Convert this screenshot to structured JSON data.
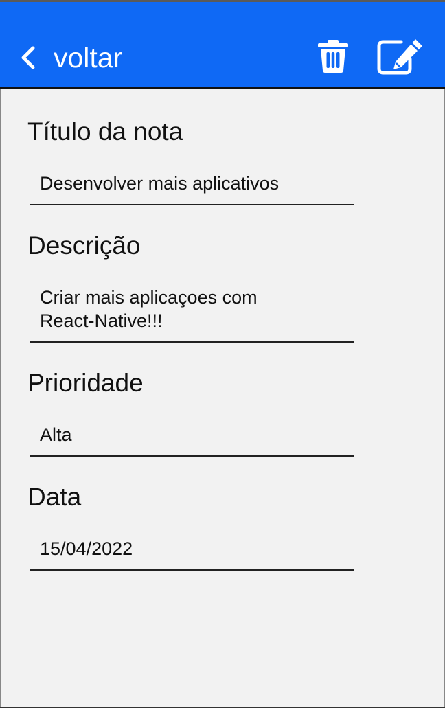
{
  "header": {
    "back_label": "voltar",
    "back_icon": "chevron-left-icon",
    "delete_icon": "trash-icon",
    "edit_icon": "edit-icon",
    "background_color": "#0f69f5"
  },
  "fields": [
    {
      "label": "Título da nota",
      "value": "Desenvolver mais aplicativos"
    },
    {
      "label": "Descrição",
      "value": "Criar mais aplicaçoes com\nReact-Native!!!"
    },
    {
      "label": "Prioridade",
      "value": "Alta"
    },
    {
      "label": "Data",
      "value": "15/04/2022"
    }
  ]
}
